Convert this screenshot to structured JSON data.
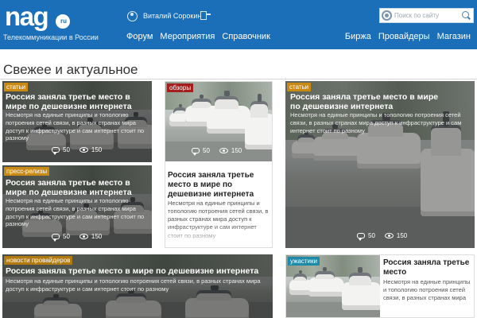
{
  "header": {
    "logo": "nag",
    "logo_badge": "ru",
    "tagline": "Телекоммуникации в России",
    "user_name": "Виталий Сорокин",
    "nav_left": [
      "Форум",
      "Мероприятия",
      "Справочник"
    ],
    "nav_right": [
      "Биржа",
      "Провайдеры",
      "Магазин"
    ],
    "search_placeholder": "Поиск по сайту",
    "icons": [
      "user-icon",
      "logout-icon",
      "gear-icon",
      "search-icon"
    ],
    "color": "#1a6fb8"
  },
  "section_title": "Свежее и актуальное",
  "tag_colors": {
    "статьи": "#c98a14",
    "обзоры": "#a51e1e",
    "пресс-релизы": "#c98a14",
    "новости провайдеров": "#b07a10",
    "ужастики": "#1f8aa8"
  },
  "cards": [
    {
      "tag": "статьи",
      "title": "Россия заняла третье место в мире по дешевизне интернета",
      "text": "Несмотря на единые принципы и топологию потроения сетей связи, в разных странах мира доступ к инфраструктуре и сам интернет стоит по разному",
      "comments": "50",
      "views": "150"
    },
    {
      "tag": "обзоры",
      "title": "Россия заняла третье место в мире по дешевизне интернета",
      "text": "Несмотря на единые принципы и топологию потроения сетей связи, в разных странах мира доступ к инфраструктуре и сам интернет стоит по разному",
      "comments": "50",
      "views": "150"
    },
    {
      "tag": "статьи",
      "title": "Россия заняла третье место в мире по дешевизне интернета",
      "text": "Несмотря на единые принципы и топологию потроения сетей связи, в разных странах мира доступ к инфраструктуре и сам интернет стоит по разному",
      "comments": "50",
      "views": "150"
    },
    {
      "tag": "пресс-релизы",
      "title": "Россия заняла третье место в мире по дешевизне интернета",
      "text": "Несмотря на единые принципы и топологию потроения сетей связи, в разных странах мира доступ к инфраструктуре и сам интернет стоит по разному",
      "comments": "50",
      "views": "150"
    },
    {
      "tag": "новости провайдеров",
      "title": "Россия заняла третье место в мире по дешевизне интернета",
      "text": "Несмотря на единые принципы и топологию потроения сетей связи, в разных странах мира доступ к инфраструктуре и сам интернет стоит по разному"
    },
    {
      "tag": "ужастики",
      "title": "Россия заняла третье место",
      "text": "Несмотря на единые принципы и топологию потроения сетей связи, в разных странах мира"
    }
  ]
}
